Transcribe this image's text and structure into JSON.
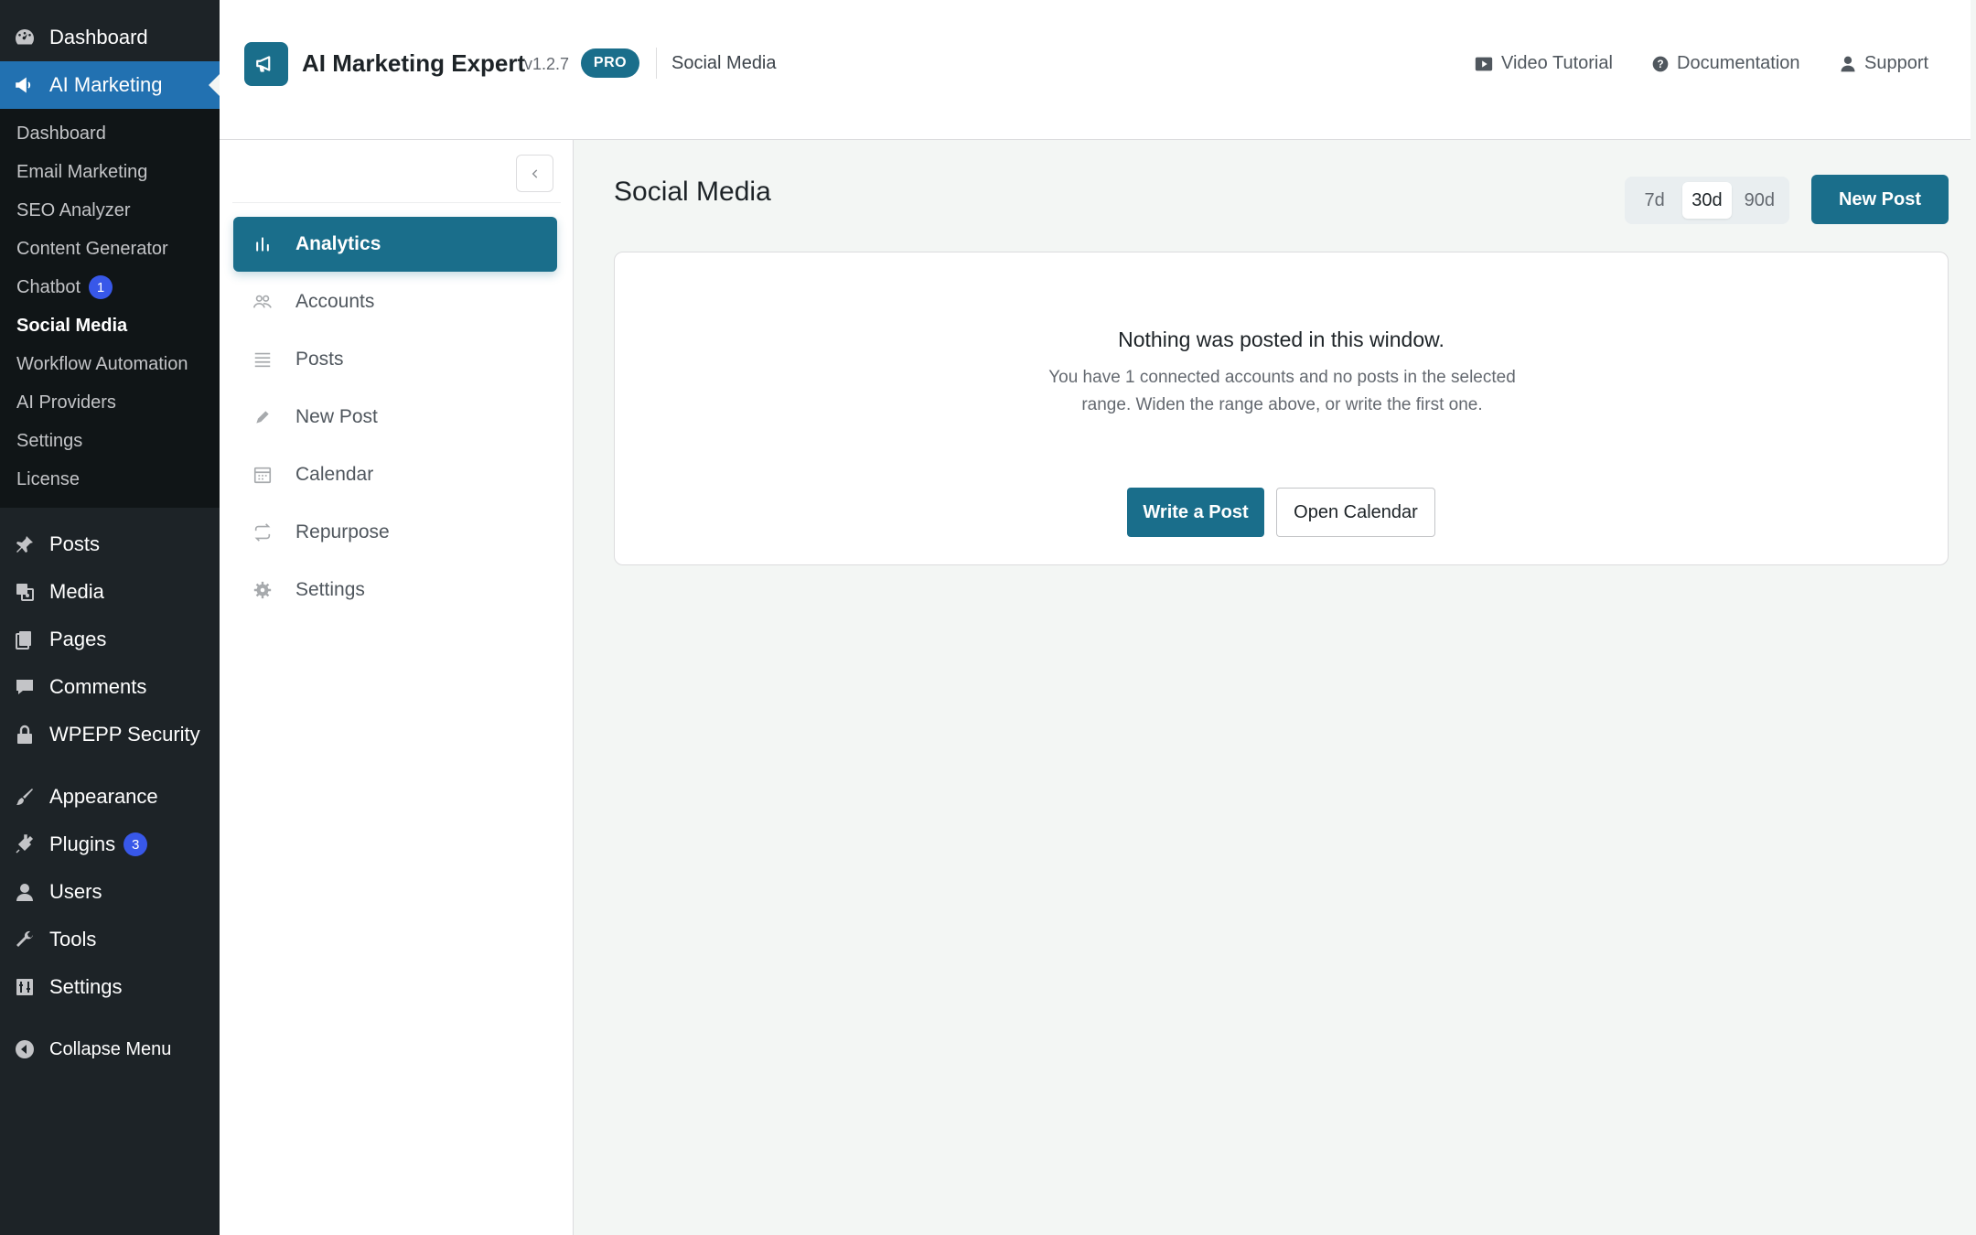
{
  "wp_menu": {
    "top": [
      {
        "label": "Dashboard",
        "icon": "dashboard-icon"
      },
      {
        "label": "AI Marketing",
        "icon": "megaphone-icon"
      }
    ],
    "submenu": [
      {
        "label": "Dashboard"
      },
      {
        "label": "Email Marketing"
      },
      {
        "label": "SEO Analyzer"
      },
      {
        "label": "Content Generator"
      },
      {
        "label": "Chatbot",
        "badge": "1"
      },
      {
        "label": "Social Media"
      },
      {
        "label": "Workflow Automation"
      },
      {
        "label": "AI Providers"
      },
      {
        "label": "Settings"
      },
      {
        "label": "License"
      }
    ],
    "items": [
      {
        "label": "Posts",
        "icon": "pin-icon"
      },
      {
        "label": "Media",
        "icon": "media-icon"
      },
      {
        "label": "Pages",
        "icon": "pages-icon"
      },
      {
        "label": "Comments",
        "icon": "comment-icon"
      },
      {
        "label": "WPEPP Security",
        "icon": "lock-icon"
      },
      {
        "label": "Appearance",
        "icon": "brush-icon"
      },
      {
        "label": "Plugins",
        "icon": "plugin-icon",
        "badge": "3"
      },
      {
        "label": "Users",
        "icon": "user-icon"
      },
      {
        "label": "Tools",
        "icon": "wrench-icon"
      },
      {
        "label": "Settings",
        "icon": "settings-icon"
      },
      {
        "label": "Collapse Menu",
        "icon": "collapse-icon"
      }
    ]
  },
  "header": {
    "title": "AI Marketing Expert",
    "version": "v1.2.7",
    "badge": "PRO",
    "section": "Social Media",
    "links": [
      {
        "label": "Video Tutorial",
        "icon": "video-icon"
      },
      {
        "label": "Documentation",
        "icon": "help-icon"
      },
      {
        "label": "Support",
        "icon": "support-icon"
      }
    ]
  },
  "nav": {
    "items": [
      {
        "label": "Analytics",
        "icon": "bar-chart-icon"
      },
      {
        "label": "Accounts",
        "icon": "accounts-icon"
      },
      {
        "label": "Posts",
        "icon": "list-icon"
      },
      {
        "label": "New Post",
        "icon": "pencil-icon"
      },
      {
        "label": "Calendar",
        "icon": "calendar-icon"
      },
      {
        "label": "Repurpose",
        "icon": "repeat-icon"
      },
      {
        "label": "Settings",
        "icon": "gear-icon"
      }
    ]
  },
  "main": {
    "title": "Social Media",
    "ranges": [
      "7d",
      "30d",
      "90d"
    ],
    "selected_range": "30d",
    "new_post_label": "New Post",
    "empty": {
      "title": "Nothing was posted in this window.",
      "text": "You have 1 connected accounts and no posts in the selected range. Widen the range above, or write the first one.",
      "primary": "Write a Post",
      "secondary": "Open Calendar"
    }
  },
  "colors": {
    "accent": "#1a6e8b",
    "wp_sidebar": "#1d2327",
    "wp_active": "#2271b1",
    "badge": "#3858e9"
  }
}
